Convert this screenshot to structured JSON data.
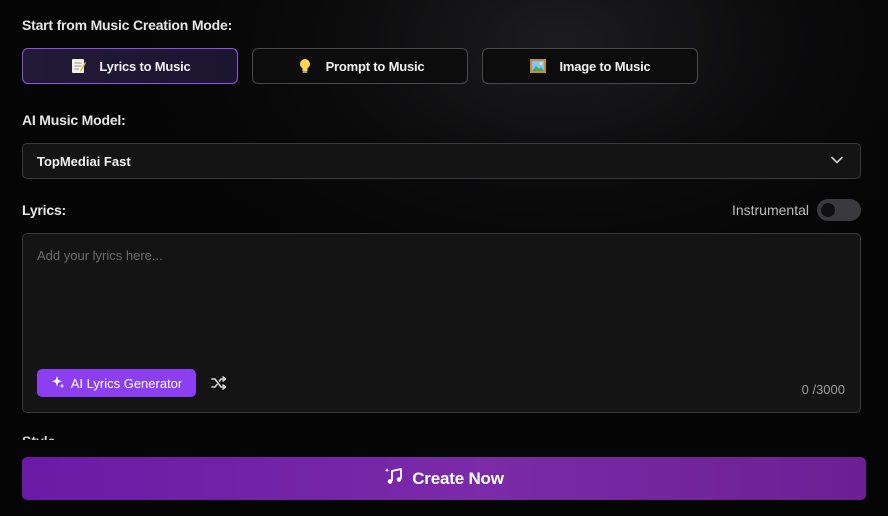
{
  "creation_mode": {
    "title": "Start from Music Creation Mode:",
    "modes": [
      {
        "label": "Lyrics to Music",
        "icon": "memo-icon",
        "active": true
      },
      {
        "label": "Prompt to Music",
        "icon": "lightbulb-icon",
        "active": false
      },
      {
        "label": "Image to Music",
        "icon": "picture-icon",
        "active": false
      }
    ]
  },
  "model": {
    "title": "AI Music Model:",
    "selected": "TopMediai Fast"
  },
  "lyrics": {
    "title": "Lyrics:",
    "instrumental_label": "Instrumental",
    "instrumental_on": false,
    "placeholder": "Add your lyrics here...",
    "value": "",
    "generator_label": "AI Lyrics Generator",
    "counter": "0 /3000"
  },
  "next_section_title": "Style",
  "create_button": {
    "label": "Create Now"
  },
  "colors": {
    "accent": "#8b3ff0",
    "create_start": "#6a1aa6",
    "create_end": "#7b2aa8"
  }
}
